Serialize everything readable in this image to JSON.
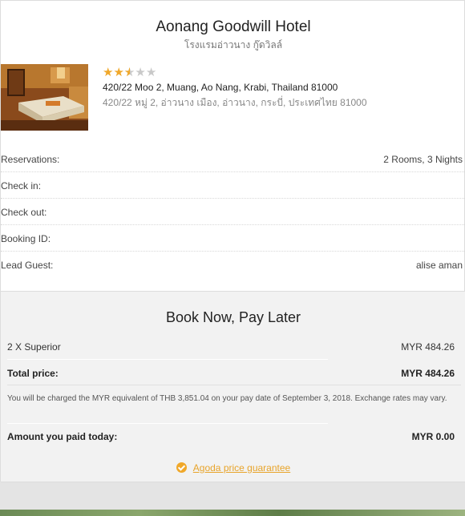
{
  "hotel": {
    "name": "Aonang Goodwill Hotel",
    "name_th": "โรงแรมอ่าวนาง กู๊ดวิลล์",
    "rating": 2.5,
    "max_rating": 5,
    "address_en": "420/22 Moo 2, Muang, Ao Nang, Krabi, Thailand 81000",
    "address_th": "420/22 หมู่ 2, อ่าวนาง เมือง, อ่าวนาง, กระบี่, ประเทศไทย 81000"
  },
  "booking": {
    "reservations_label": "Reservations:",
    "reservations_value": "2 Rooms, 3 Nights",
    "checkin_label": "Check in:",
    "checkin_value": "",
    "checkout_label": "Check out:",
    "checkout_value": "",
    "booking_id_label": "Booking ID:",
    "booking_id_value": "",
    "lead_guest_label": "Lead Guest:",
    "lead_guest_value": "alise aman"
  },
  "payment": {
    "title": "Book Now, Pay Later",
    "room_label": "2 X Superior",
    "room_price": "MYR 484.26",
    "total_label": "Total price:",
    "total_value": "MYR 484.26",
    "note": "You will be charged the MYR equivalent of THB 3,851.04 on your pay date of September 3, 2018. Exchange rates may vary.",
    "paid_today_label": "Amount you paid today:",
    "paid_today_value": "MYR 0.00",
    "guarantee_label": "Agoda price guarantee"
  },
  "colors": {
    "star": "#f0a82a",
    "link": "#e8a42a"
  }
}
